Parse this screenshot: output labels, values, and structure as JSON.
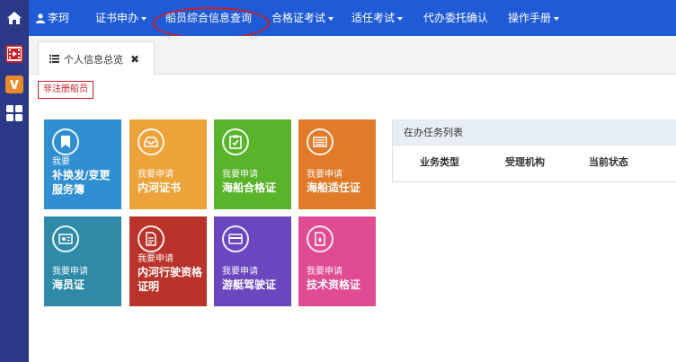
{
  "nav": {
    "user_name": "李珂",
    "items": [
      {
        "label": "证书申办",
        "dropdown": true
      },
      {
        "label": "船员综合信息查询",
        "dropdown": false
      },
      {
        "label": "合格证考试",
        "dropdown": true
      },
      {
        "label": "适任考试",
        "dropdown": true
      },
      {
        "label": "代办委托确认",
        "dropdown": false
      },
      {
        "label": "操作手册",
        "dropdown": true
      }
    ],
    "highlighted_item": "船员综合信息查询"
  },
  "tab": {
    "label": "个人信息总览"
  },
  "badge": {
    "label": "非注册船员"
  },
  "tiles": [
    {
      "sub": "我要",
      "main": "补换发/变更服务簿",
      "color": "#2f8fd0",
      "icon": "bookmark-icon"
    },
    {
      "sub": "我要申请",
      "main": "内河证书",
      "color": "#eba33a",
      "icon": "inbox-icon"
    },
    {
      "sub": "我要申请",
      "main": "海船合格证",
      "color": "#59b32b",
      "icon": "clipboard-check-icon"
    },
    {
      "sub": "我要申请",
      "main": "海船适任证",
      "color": "#e07b2a",
      "icon": "list-icon"
    },
    {
      "sub": "我要申请",
      "main": "海员证",
      "color": "#2f8aa8",
      "icon": "id-card-icon"
    },
    {
      "sub": "我要申请",
      "main": "内河行驶资格证明",
      "color": "#b9332b",
      "icon": "document-icon"
    },
    {
      "sub": "我要申请",
      "main": "游艇驾驶证",
      "color": "#6a46bf",
      "icon": "card-icon"
    },
    {
      "sub": "我要申请",
      "main": "技术资格证",
      "color": "#e04c92",
      "icon": "badge-icon"
    }
  ],
  "task_panel": {
    "title": "在办任务列表",
    "columns": [
      "业务类型",
      "受理机构",
      "当前状态"
    ]
  },
  "colors": {
    "navbar": "#1f5bd6",
    "sidebar": "#2a3a86",
    "highlight": "#c8202a"
  }
}
